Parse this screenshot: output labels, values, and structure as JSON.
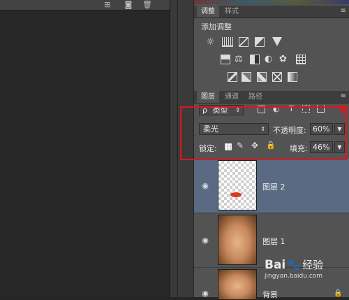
{
  "left_toolbar": {
    "icons": [
      "new-layer-icon",
      "camera-icon",
      "trash-icon"
    ]
  },
  "adjustments_panel": {
    "tabs": [
      {
        "label": "调整"
      },
      {
        "label": "样式"
      }
    ],
    "title": "添加调整",
    "icon_rows": [
      [
        "brightness-icon",
        "levels-icon",
        "curves-icon",
        "exposure-icon",
        "triangle-icon"
      ],
      [
        "vibrance-icon",
        "balance-icon",
        "bw-icon",
        "photo-filter-icon",
        "channel-mixer-icon",
        "lookup-icon"
      ],
      [
        "invert-icon",
        "posterize-icon",
        "threshold-icon",
        "selective-color-icon",
        "gradient-map-icon"
      ]
    ]
  },
  "layers_panel": {
    "tabs": [
      {
        "label": "图层"
      },
      {
        "label": "通道"
      },
      {
        "label": "路径"
      }
    ],
    "filter": {
      "value": "类型",
      "search_prefix": "ρ"
    },
    "blend_mode": {
      "value": "柔光"
    },
    "opacity": {
      "label": "不透明度:",
      "value": "60%"
    },
    "lock": {
      "label": "锁定:"
    },
    "fill": {
      "label": "填充:",
      "value": "46%"
    },
    "layers": [
      {
        "name": "图层 2",
        "selected": true
      },
      {
        "name": "图层 1",
        "selected": false
      },
      {
        "name": "背景",
        "selected": false
      }
    ]
  },
  "watermark": {
    "brand": "Bai",
    "brand2": "经验",
    "url": "jingyan.baidu.com"
  },
  "colors": {
    "highlight": "#e0141e",
    "selected_row": "#596a82",
    "panel": "#535353"
  }
}
